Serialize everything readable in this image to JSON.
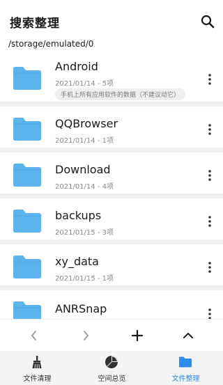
{
  "header": {
    "title": "搜索整理",
    "search_icon": "search-icon",
    "path": "/storage/emulated/0"
  },
  "folders": [
    {
      "name": "Android",
      "meta": "2021/01/14 - 5项",
      "note": "手机上所有应用软件的数据（不建议动它）"
    },
    {
      "name": "QQBrowser",
      "meta": "2021/01/14 - 1项"
    },
    {
      "name": "Download",
      "meta": "2021/01/14 - 4项"
    },
    {
      "name": "backups",
      "meta": "2021/01/15 - 3项"
    },
    {
      "name": "xy_data",
      "meta": "2021/01/15 - 1项"
    },
    {
      "name": "ANRSnap",
      "meta": ""
    }
  ],
  "toolbar": {
    "icons": [
      "chevron-left-icon",
      "chevron-right-icon",
      "plus-icon",
      "chevron-up-icon"
    ]
  },
  "bottom_nav": {
    "items": [
      {
        "label": "文件清理",
        "icon": "broom-icon"
      },
      {
        "label": "空间总览",
        "icon": "pie-chart-icon"
      },
      {
        "label": "文件整理",
        "icon": "folder-icon"
      }
    ],
    "active_index": 2
  },
  "colors": {
    "folder": "#5bb4ee",
    "active": "#2f8ceb",
    "divider": "#f1f1f1",
    "nav_bg": "#f4f4f4"
  }
}
